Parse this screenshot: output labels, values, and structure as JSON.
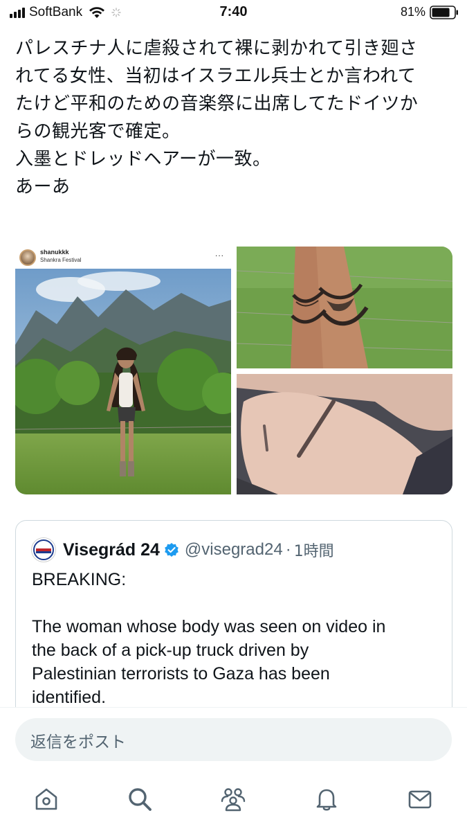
{
  "status_bar": {
    "carrier": "SoftBank",
    "time": "7:40",
    "battery": "81%",
    "battery_level": 0.81
  },
  "tweet": {
    "text": "パレスチナ人に虐殺されて裸に剥かれて引き廻さ\nれてる女性、当初はイスラエル兵士とか言われて\nたけど平和のための音楽祭に出席してたドイツか\nらの観光客で確定。\n入墨とドレッドヘアーが一致。\nあーあ"
  },
  "media": {
    "instagram": {
      "username": "shanukkk",
      "location": "Shankra Festival",
      "more": "..."
    }
  },
  "quote": {
    "name": "Visegrád 24",
    "handle": "@visegrad24",
    "separator": "·",
    "time": "1時間",
    "body": "BREAKING:\n\nThe woman whose body was seen on video in\nthe back of a pick-up truck driven by\nPalestinian terrorists to Gaza has been\nidentified."
  },
  "reply": {
    "placeholder": "返信をポスト"
  },
  "tabs": [
    {
      "name": "home",
      "icon": "home-icon"
    },
    {
      "name": "search",
      "icon": "search-icon"
    },
    {
      "name": "communities",
      "icon": "communities-icon"
    },
    {
      "name": "notifications",
      "icon": "bell-icon"
    },
    {
      "name": "messages",
      "icon": "mail-icon"
    }
  ],
  "colors": {
    "text": "#0f1419",
    "secondary": "#536471",
    "verified": "#1d9bf0",
    "border": "#cfd9de"
  }
}
